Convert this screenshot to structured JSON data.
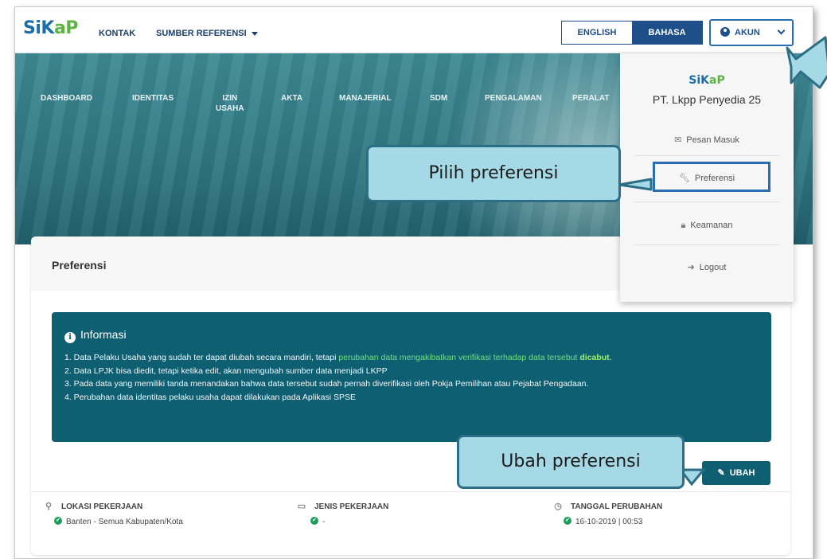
{
  "header": {
    "logo": {
      "part1": "SiK",
      "part2": "aP"
    },
    "nav": {
      "kontak": "KONTAK",
      "sumber": "SUMBER REFERENSI"
    },
    "lang": {
      "english": "ENGLISH",
      "bahasa": "BAHASA"
    },
    "akun": "AKUN"
  },
  "menu": {
    "dashboard": "DASHBOARD",
    "identitas": "IDENTITAS",
    "izin_1": "IZIN",
    "izin_2": "USAHA",
    "akta": "AKTA",
    "manajerial": "MANAJERIAL",
    "sdm": "SDM",
    "pengalaman": "PENGALAMAN",
    "peralatan": "PERALAT"
  },
  "dropdown": {
    "company": "PT. Lkpp Penyedia 25",
    "pesan": "Pesan Masuk",
    "preferensi": "Preferensi",
    "keamanan": "Keamanan",
    "logout": "Logout"
  },
  "card": {
    "title": "Preferensi",
    "info": {
      "title": "Informasi",
      "line1_a": "1. Data Pelaku Usaha yang sudah ter dapat diubah secara mandiri, tetapi ",
      "line1_b": "perubahan data mengakibatkan verifikasi terhadap data tersebut ",
      "line1_c": "dicabut",
      "line1_d": ".",
      "line2": "2. Data LPJK bisa diedit, tetapi ketika edit, akan mengubah sumber data menjadi LKPP",
      "line3": "3. Pada data yang memiliki tanda menandakan bahwa data tersebut sudah pernah diverifikasi oleh Pokja Pemilihan atau Pejabat Pengadaan.",
      "line4": "4. Perubahan data identitas pelaku usaha dapat dilakukan pada Aplikasi SPSE"
    },
    "ubah_label": "UBAH",
    "meta": {
      "lokasi_label": "LOKASI PEKERJAAN",
      "lokasi_value": "Banten - Semua Kabupaten/Kota",
      "jenis_label": "JENIS PEKERJAAN",
      "jenis_value": "-",
      "tanggal_label": "TANGGAL PERUBAHAN",
      "tanggal_value": "16-10-2019 | 00:53"
    }
  },
  "callouts": {
    "pilih": "Pilih preferensi",
    "ubah": "Ubah preferensi"
  },
  "colors": {
    "brand_blue": "#1e4f8a",
    "teal": "#0f5f73",
    "callout_fill": "#a6d9e6",
    "highlight_border": "#2a6db5"
  }
}
